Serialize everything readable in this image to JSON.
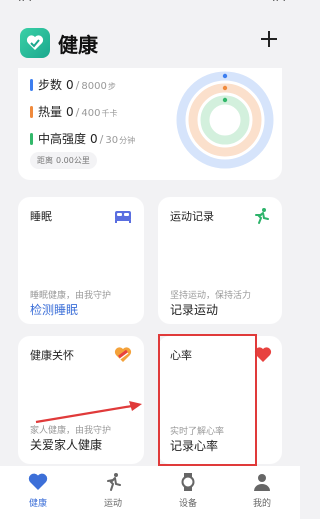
{
  "header": {
    "title": "健康"
  },
  "summary": {
    "metrics": [
      {
        "label": "步数",
        "value": "0",
        "target": "8000",
        "unit": "步",
        "color": "#3c7ef0"
      },
      {
        "label": "热量",
        "value": "0",
        "target": "400",
        "unit": "千卡",
        "color": "#f08a3c"
      },
      {
        "label": "中高强度",
        "value": "0",
        "target": "30",
        "unit": "分钟",
        "color": "#32b86a"
      }
    ],
    "distance_label": "距离",
    "distance_value": "0.00公里"
  },
  "cards": {
    "sleep": {
      "title": "睡眠",
      "desc": "睡眠健康，由我守护",
      "action": "检测睡眠",
      "icon": "bed-icon"
    },
    "exercise": {
      "title": "运动记录",
      "desc": "坚持运动，保持活力",
      "action": "记录运动",
      "icon": "running-icon"
    },
    "family": {
      "title": "健康关怀",
      "desc": "家人健康，由我守护",
      "action": "关爱家人健康",
      "icon": "care-heart-icon"
    },
    "heart_rate": {
      "title": "心率",
      "desc": "实时了解心率",
      "action": "记录心率",
      "icon": "heart-icon"
    }
  },
  "tabs": [
    {
      "label": "健康",
      "icon": "heart-icon",
      "active": true
    },
    {
      "label": "运动",
      "icon": "running-icon",
      "active": false
    },
    {
      "label": "设备",
      "icon": "watch-icon",
      "active": false
    },
    {
      "label": "我的",
      "icon": "person-icon",
      "active": false
    }
  ],
  "colors": {
    "accent": "#3c6fd8",
    "highlight": "#e03a3a",
    "heart": "#e8423f"
  }
}
